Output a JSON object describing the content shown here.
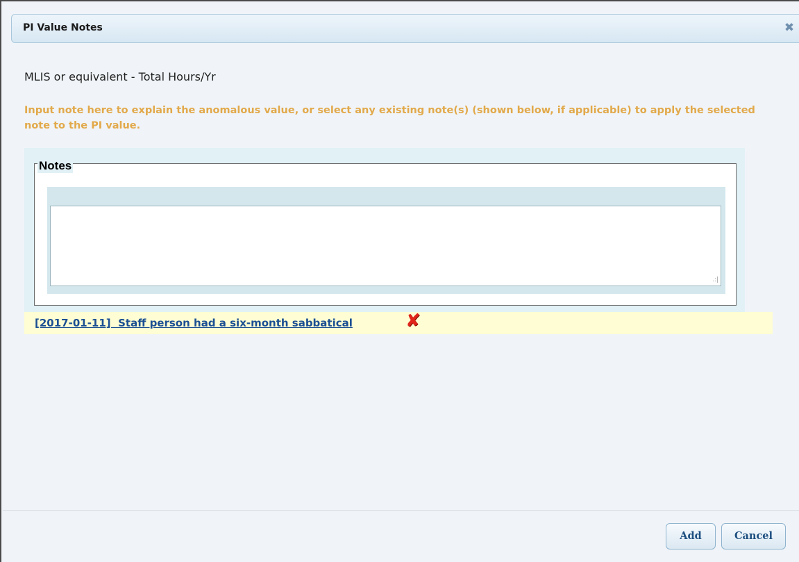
{
  "dialog": {
    "title": "PI Value Notes",
    "close_icon": "✖"
  },
  "content": {
    "pi_name": "MLIS or equivalent - Total Hours/Yr",
    "instruction": "Input note here to explain the anomalous value, or select any existing note(s) (shown below, if applicable) to apply the selected note to the PI value."
  },
  "notes": {
    "legend": "Notes",
    "input_value": "",
    "existing": [
      {
        "text": "[2017-01-11]  Staff person had a six-month sabbatical",
        "delete_icon": "✘"
      }
    ]
  },
  "buttons": {
    "add_label": "Add",
    "cancel_label": "Cancel"
  },
  "colors": {
    "instruction_text": "#e2a94b",
    "note_link": "#1b4f93",
    "delete_icon": "#e0251b",
    "existing_note_bg": "#fefdd3",
    "notes_panel_bg": "#e1f1f6"
  }
}
